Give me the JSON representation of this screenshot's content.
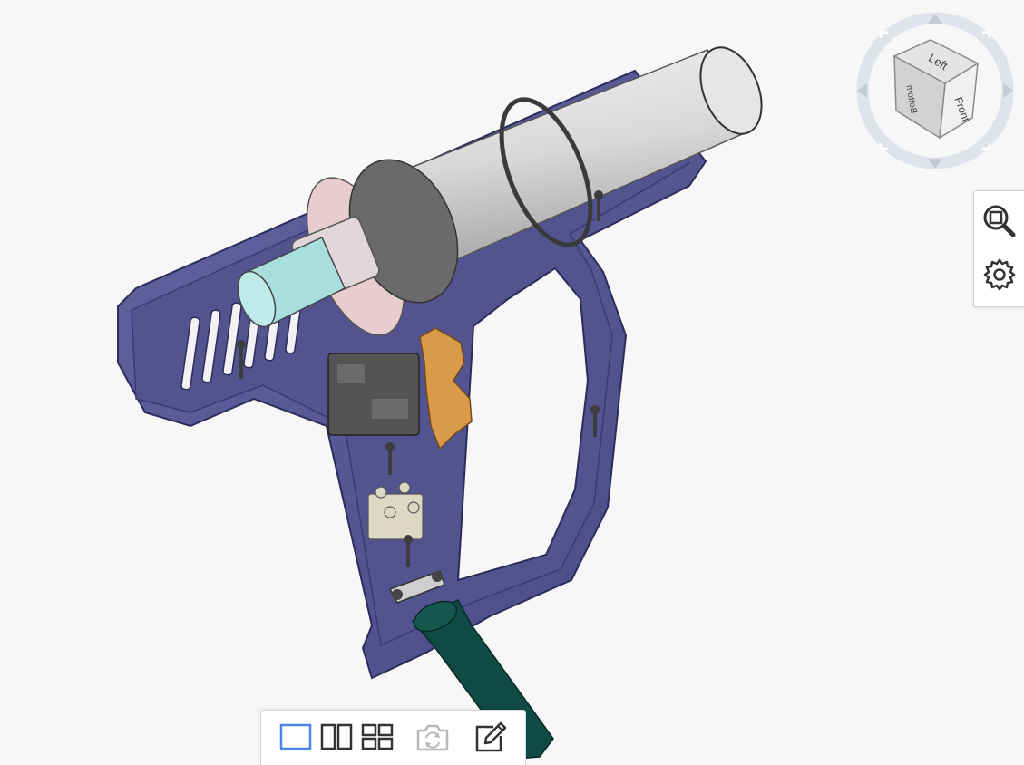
{
  "viewport": {
    "model_name": "",
    "colors": {
      "background": "#f7f7f7",
      "housing": "#5a5a96",
      "housing_inner": "#4a4a84",
      "heating_tube": "#dcdcdc",
      "motor_cylinder": "#a9dede",
      "switch_block": "#555555",
      "trigger": "#d99a4a",
      "cable": "#0f4a44"
    }
  },
  "view_cube": {
    "faces": {
      "top": "Left",
      "right": "Front",
      "left": "Bottom"
    },
    "arrows": [
      "rotate-up",
      "rotate-down",
      "rotate-left",
      "rotate-right"
    ]
  },
  "side_tools": [
    {
      "name": "zoom-fit",
      "icon": "zoom-fit-icon"
    },
    {
      "name": "settings",
      "icon": "gear-icon"
    }
  ],
  "bottom_toolbar": [
    {
      "name": "single-view",
      "icon": "single-view-icon",
      "active": true
    },
    {
      "name": "two-views",
      "icon": "two-views-icon",
      "active": false
    },
    {
      "name": "four-views",
      "icon": "four-views-icon",
      "active": false
    },
    {
      "name": "snapshot",
      "icon": "camera-icon",
      "disabled": true
    },
    {
      "name": "markup",
      "icon": "edit-icon",
      "active": false
    }
  ]
}
